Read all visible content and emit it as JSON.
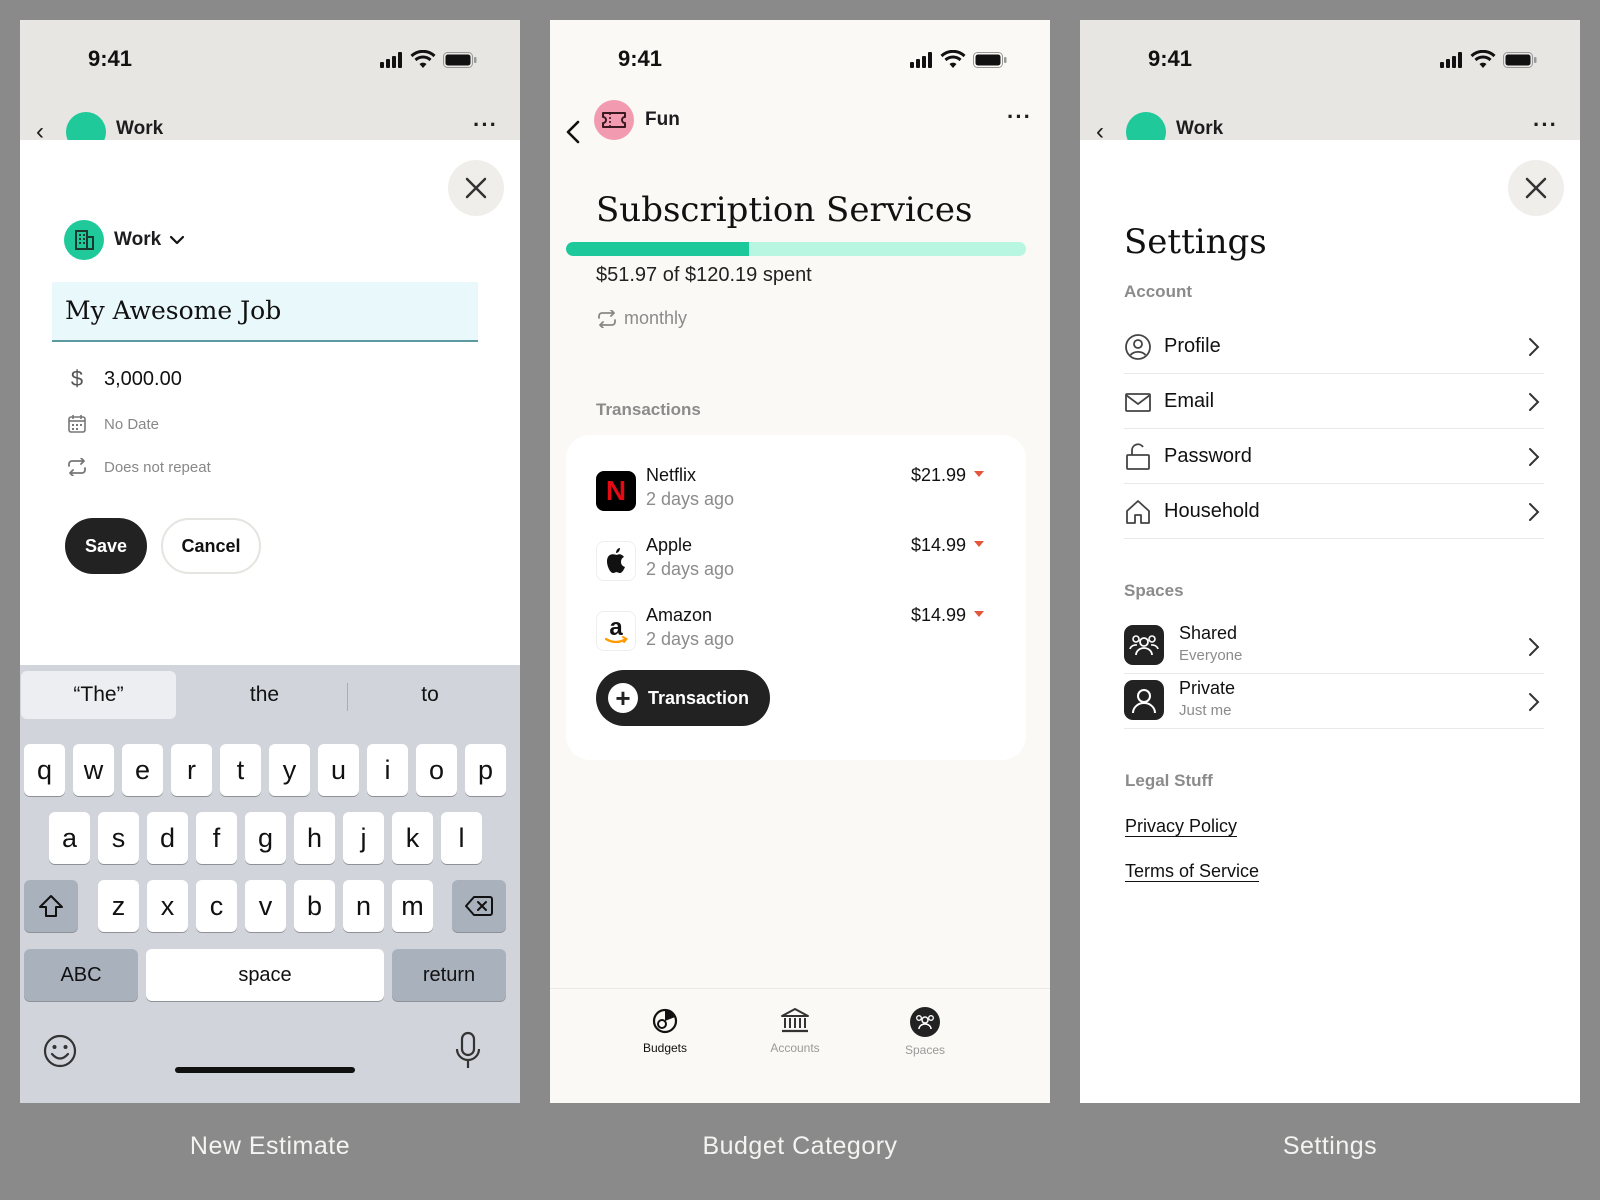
{
  "status": {
    "time": "9:41"
  },
  "colors": {
    "accent_green": "#1dc89b",
    "progress_track": "#b9f6e2",
    "fun_pink": "#f29bb0",
    "down_arrow": "#e4553a",
    "dark": "#222222"
  },
  "new_estimate": {
    "caption": "New Estimate",
    "peek_nav": {
      "label": "Work",
      "icon": "building-icon"
    },
    "space_picker": {
      "label": "Work",
      "icon": "building-icon"
    },
    "title_value": "My Awesome Job",
    "amount": "3,000.00",
    "date": "No Date",
    "repeat": "Does not repeat",
    "save_label": "Save",
    "cancel_label": "Cancel",
    "keyboard": {
      "suggestions": [
        "“The”",
        "the",
        "to"
      ],
      "row1": [
        "q",
        "w",
        "e",
        "r",
        "t",
        "y",
        "u",
        "i",
        "o",
        "p"
      ],
      "row2": [
        "a",
        "s",
        "d",
        "f",
        "g",
        "h",
        "j",
        "k",
        "l"
      ],
      "row3": [
        "z",
        "x",
        "c",
        "v",
        "b",
        "n",
        "m"
      ],
      "abc_label": "ABC",
      "space_label": "space",
      "return_label": "return"
    }
  },
  "budget_category": {
    "caption": "Budget Category",
    "nav_label": "Fun",
    "title": "Subscription Services",
    "progress_fraction": 0.398,
    "spent_text": "$51.97 of $120.19 spent",
    "frequency": "monthly",
    "transactions_header": "Transactions",
    "transactions": [
      {
        "name": "Netflix",
        "date": "2 days ago",
        "amount": "$21.99",
        "logo": "netflix-logo"
      },
      {
        "name": "Apple",
        "date": "2 days ago",
        "amount": "$14.99",
        "logo": "apple-logo"
      },
      {
        "name": "Amazon",
        "date": "2 days ago",
        "amount": "$14.99",
        "logo": "amazon-logo"
      }
    ],
    "add_transaction_label": "Transaction",
    "tabs": [
      {
        "label": "Budgets",
        "active": true
      },
      {
        "label": "Accounts",
        "active": false
      },
      {
        "label": "Spaces",
        "active": false
      }
    ]
  },
  "settings": {
    "caption": "Settings",
    "peek_nav": {
      "label": "Work"
    },
    "title": "Settings",
    "account_header": "Account",
    "account_items": [
      {
        "label": "Profile",
        "icon": "user-circle-icon"
      },
      {
        "label": "Email",
        "icon": "envelope-icon"
      },
      {
        "label": "Password",
        "icon": "unlock-icon"
      },
      {
        "label": "Household",
        "icon": "house-icon"
      }
    ],
    "spaces_header": "Spaces",
    "spaces": [
      {
        "label": "Shared",
        "sub": "Everyone",
        "icon": "group-icon"
      },
      {
        "label": "Private",
        "sub": "Just me",
        "icon": "person-icon"
      }
    ],
    "legal_header": "Legal Stuff",
    "privacy_label": "Privacy Policy",
    "terms_label": "Terms of Service"
  }
}
